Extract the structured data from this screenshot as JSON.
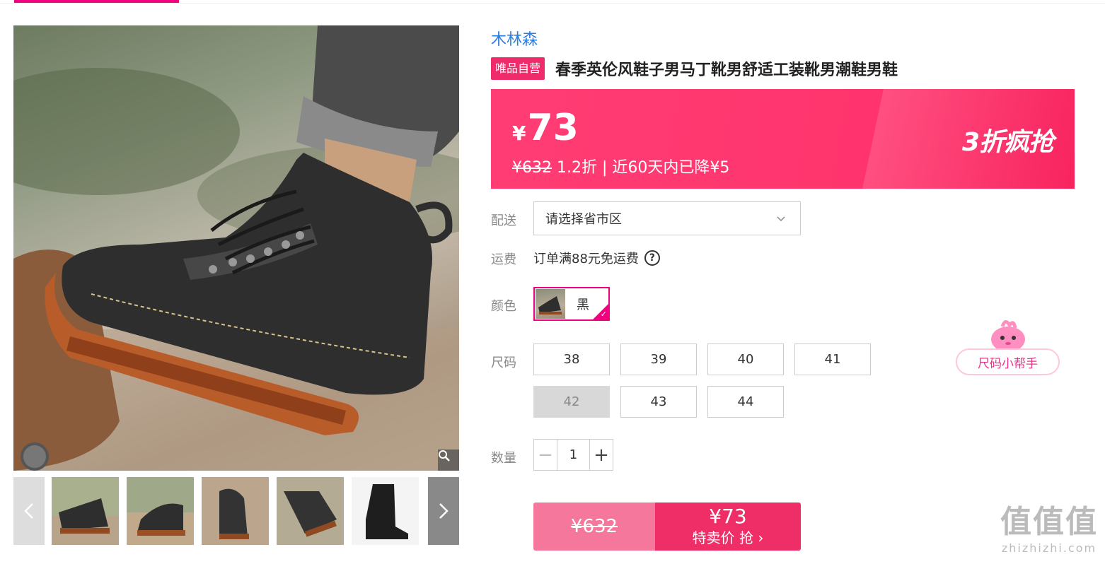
{
  "brand": "木林森",
  "title": {
    "tag": "唯品自营",
    "text": "春季英伦风鞋子男马丁靴男舒适工装靴男潮鞋男鞋"
  },
  "price": {
    "currency": "¥",
    "current": "73",
    "original": "¥632",
    "discount_info": " 1.2折 | 近60天内已降¥5",
    "promo": "3折疯抢",
    "accent_color": "#ff3d74"
  },
  "delivery": {
    "label": "配送",
    "placeholder": "请选择省市区"
  },
  "shipping": {
    "label": "运费",
    "text": "订单满88元免运费",
    "help_icon": "?"
  },
  "color": {
    "label": "颜色",
    "selected": "黑"
  },
  "size": {
    "label": "尺码",
    "options": [
      "38",
      "39",
      "40",
      "41",
      "42",
      "43",
      "44"
    ],
    "disabled": [
      "42"
    ]
  },
  "quantity": {
    "label": "数量",
    "minus": "−",
    "value": "1",
    "plus": "+"
  },
  "buy": {
    "original": "¥632",
    "price": "¥73",
    "action": "特卖价 抢 ›"
  },
  "size_helper": "尺码小帮手",
  "watermark": {
    "big": "值值值",
    "small": "zhizhizhi.com"
  }
}
